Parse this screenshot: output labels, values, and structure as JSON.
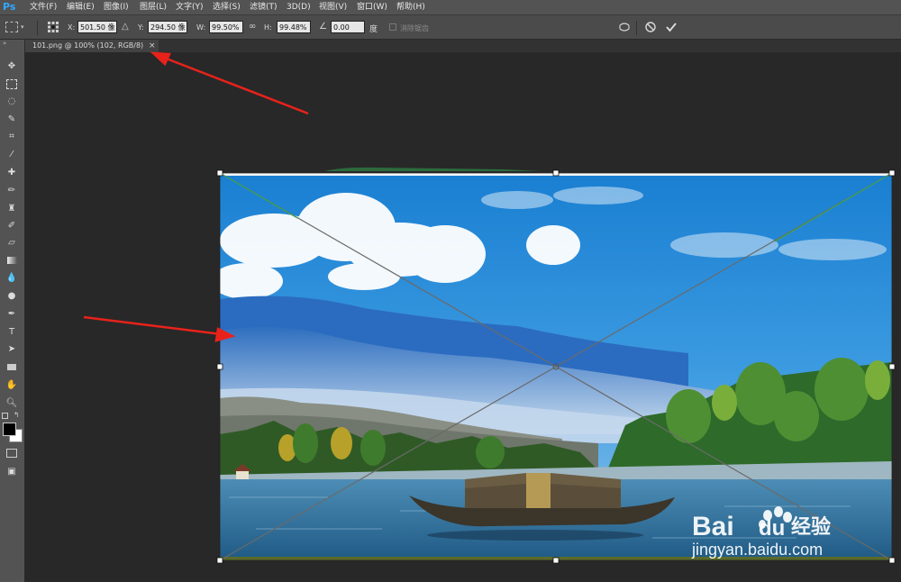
{
  "app": {
    "logo": "Ps"
  },
  "menu": [
    "文件(F)",
    "编辑(E)",
    "图像(I)",
    "图层(L)",
    "文字(Y)",
    "选择(S)",
    "滤镜(T)",
    "3D(D)",
    "视图(V)",
    "窗口(W)",
    "帮助(H)"
  ],
  "options": {
    "x_label": "X:",
    "x_value": "501.50 像",
    "y_label": "Y:",
    "y_value": "294.50 像",
    "w_label": "W:",
    "w_value": "99.50%",
    "h_label": "H:",
    "h_value": "99.48%",
    "angle_value": "0.00",
    "angle_unit": "度",
    "antialias_label": "消除锯齿"
  },
  "tab": {
    "title": "101.png @ 100% (102, RGB/8)",
    "close": "×"
  },
  "watermark": {
    "brand": "Bai",
    "brand2": "du",
    "product": "经验",
    "url": "jingyan.baidu.com"
  },
  "colors": {
    "ps_blue": "#31a8ff",
    "arrow_red": "#e8221b",
    "ui_dark": "#535353"
  }
}
